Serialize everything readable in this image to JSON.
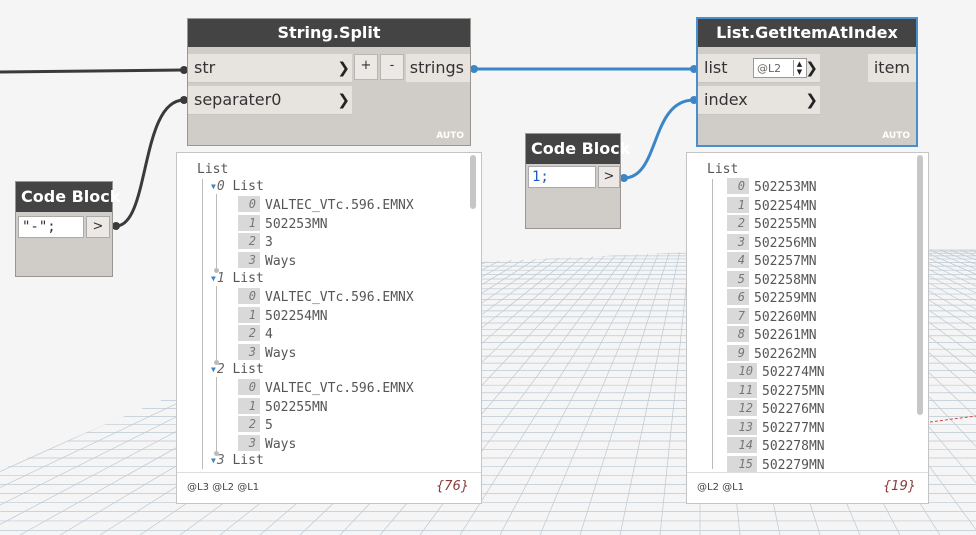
{
  "string_split": {
    "title": "String.Split",
    "inputs": [
      "str",
      "separater0"
    ],
    "output": "strings",
    "plus": "+",
    "minus": "-",
    "auto": "AUTO"
  },
  "get_item": {
    "title": "List.GetItemAtIndex",
    "inputs": [
      "list",
      "index"
    ],
    "output": "item",
    "level": "@L2",
    "auto": "AUTO"
  },
  "code_block_1": {
    "title": "Code Block",
    "code": "\"-\";",
    "out": ">"
  },
  "code_block_2": {
    "title": "Code Block",
    "code": "1;",
    "out": ">"
  },
  "chevron": "❯",
  "preview_left": {
    "root": "List",
    "sublists": [
      {
        "index": "0",
        "label": "List",
        "items": [
          "VALTEC_VTc.596.EMNX",
          "502253MN",
          "3",
          "Ways"
        ]
      },
      {
        "index": "1",
        "label": "List",
        "items": [
          "VALTEC_VTc.596.EMNX",
          "502254MN",
          "4",
          "Ways"
        ]
      },
      {
        "index": "2",
        "label": "List",
        "items": [
          "VALTEC_VTc.596.EMNX",
          "502255MN",
          "5",
          "Ways"
        ]
      },
      {
        "index": "3",
        "label": "List",
        "items": []
      }
    ],
    "levels": "@L3 @L2 @L1",
    "count": "{76}"
  },
  "preview_right": {
    "root": "List",
    "items": [
      "502253MN",
      "502254MN",
      "502255MN",
      "502256MN",
      "502257MN",
      "502258MN",
      "502259MN",
      "502260MN",
      "502261MN",
      "502262MN",
      "502274MN",
      "502275MN",
      "502276MN",
      "502277MN",
      "502278MN",
      "502279MN"
    ],
    "levels": "@L2 @L1",
    "count": "{19}"
  },
  "colors": {
    "wire_blue": "#3b86c8",
    "wire_dark": "#3a3a3a",
    "node_header": "#444444",
    "selected": "#4a8fcd"
  }
}
